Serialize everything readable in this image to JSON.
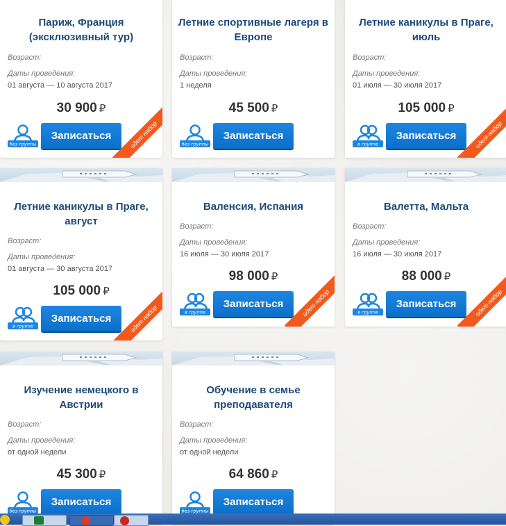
{
  "labels": {
    "age": "Возраст:",
    "dates": "Даты проведения:",
    "button": "Записаться",
    "currency": "₽",
    "ribbon": "идет набор",
    "no_group": "без группы",
    "in_group": "в группе"
  },
  "cards": [
    {
      "title_1": "Париж, Франция",
      "title_2": "(эксклюзивный тур)",
      "dates": "01 августа — 10 августа 2017",
      "price": "30 900",
      "group": "без группы"
    },
    {
      "title_1": "Летние спортивные лагеря в",
      "title_2": "Европе",
      "dates": "1 неделя",
      "price": "45 500",
      "group": "без группы"
    },
    {
      "title_1": "Летние каникулы в Праге,",
      "title_2": "июль",
      "dates": "01 июля — 30 июля 2017",
      "price": "105 000",
      "group": "в группе"
    },
    {
      "title_1": "Летние каникулы в Праге,",
      "title_2": "август",
      "dates": "01 августа — 30 августа 2017",
      "price": "105 000",
      "group": "в группе"
    },
    {
      "title_1": "Валенсия, Испания",
      "title_2": "",
      "dates": "16 июля — 30 июля 2017",
      "price": "98 000",
      "group": "в группе"
    },
    {
      "title_1": "Валетта, Мальта",
      "title_2": "",
      "dates": "16 июля — 30 июля 2017",
      "price": "88 000",
      "group": "в группе"
    },
    {
      "title_1": "Изучение немецкого в",
      "title_2": "Австрии",
      "dates": "от одной недели",
      "price": "45 300",
      "group": "без группы"
    },
    {
      "title_1": "Обучение в семье",
      "title_2": "преподавателя",
      "dates": "от одной недели",
      "price": "64 860",
      "group": "без группы"
    }
  ],
  "colors": {
    "title": "#1d4a7a",
    "button": "#0b6fca",
    "ribbon": "#f25a1d",
    "group_icon": "#1e86e0"
  }
}
